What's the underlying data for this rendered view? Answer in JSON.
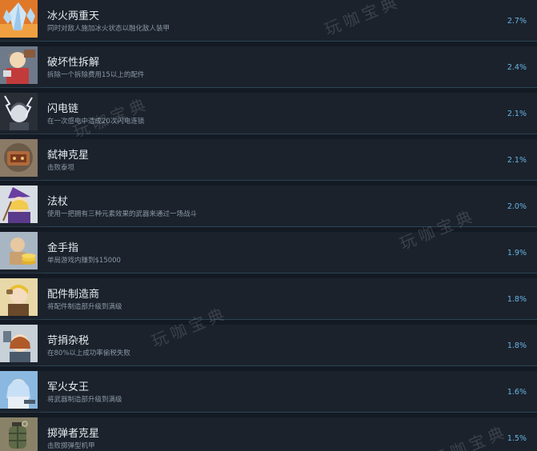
{
  "achievements": [
    {
      "title": "冰火两重天",
      "desc": "同时对敌人施加冰火状态以融化敌人装甲",
      "percent": "2.7%",
      "icon": "ice-crystal-icon"
    },
    {
      "title": "破坏性拆解",
      "desc": "拆除一个拆除费用15以上的配件",
      "percent": "2.4%",
      "icon": "demolition-character-icon"
    },
    {
      "title": "闪电链",
      "desc": "在一次感电中造成20次闪电连锁",
      "percent": "2.1%",
      "icon": "lightning-character-icon"
    },
    {
      "title": "弑神克星",
      "desc": "击败泰坦",
      "percent": "2.1%",
      "icon": "titan-mech-icon"
    },
    {
      "title": "法杖",
      "desc": "使用一把拥有三种元素效果的武器来通过一场战斗",
      "percent": "2.0%",
      "icon": "witch-staff-icon"
    },
    {
      "title": "金手指",
      "desc": "单局游戏内赚到$15000",
      "percent": "1.9%",
      "icon": "gold-coins-icon"
    },
    {
      "title": "配件制造商",
      "desc": "将配件制造部升级到满级",
      "percent": "1.8%",
      "icon": "parts-maker-icon"
    },
    {
      "title": "苛捐杂税",
      "desc": "在80%以上成功率偷税失败",
      "percent": "1.8%",
      "icon": "tax-character-icon"
    },
    {
      "title": "军火女王",
      "desc": "将武器制造部升级到满级",
      "percent": "1.6%",
      "icon": "arms-queen-icon"
    },
    {
      "title": "掷弹者克星",
      "desc": "击败掷弹型机甲",
      "percent": "1.5%",
      "icon": "grenade-icon"
    }
  ],
  "watermark": "玩咖宝典",
  "colors": {
    "percent": "#67b6e6",
    "title": "#e6ebef",
    "desc": "#8a98a5",
    "row_bg": "#1b222c",
    "page_bg": "#141a23"
  }
}
